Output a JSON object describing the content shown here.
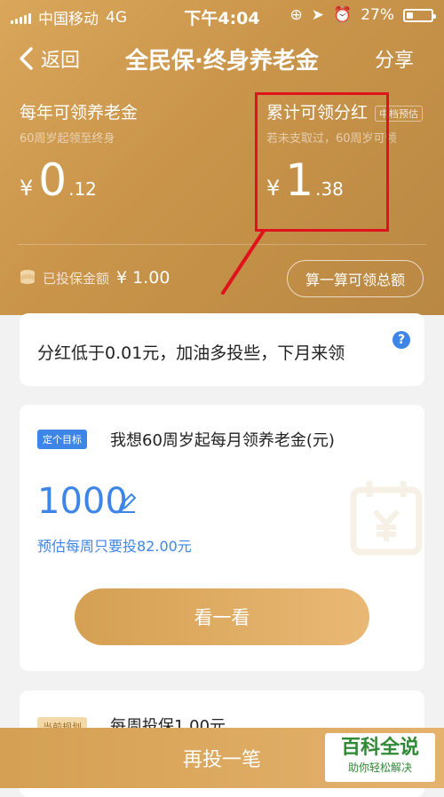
{
  "status_bar": {
    "carrier": "中国移动",
    "network": "4G",
    "time": "下午4:04",
    "battery": "27%",
    "battery_level": 0.27
  },
  "nav": {
    "back_label": "返回",
    "title": "全民保·终身养老金",
    "share_label": "分享"
  },
  "annual": {
    "title": "每年可领养老金",
    "subtitle": "60周岁起领至终身",
    "currency": "¥",
    "integer": "0",
    "decimal": ".12"
  },
  "dividend": {
    "title": "累计可领分红",
    "tag": "中档预估",
    "subtitle": "若未支取过，60周岁可领",
    "currency": "¥",
    "integer": "1",
    "decimal": ".38"
  },
  "insured": {
    "label": "已投保金额",
    "value": "¥ 1.00"
  },
  "calc_button": "算一算可领总额",
  "notice": {
    "text": "分红低于0.01元，加油多投些，下月来领",
    "help": "?"
  },
  "goal": {
    "badge": "定个目标",
    "title": "我想60周岁起每月领养老金(元)",
    "amount": "1000",
    "estimate": "预估每周只要投82.00元",
    "button": "看一看"
  },
  "plan": {
    "badge": "当前规划",
    "title": "每周投保1.00元"
  },
  "bottom_button": "再投一笔",
  "watermark": {
    "title": "百科全说",
    "subtitle": "助你轻松解决"
  },
  "colors": {
    "brand_gold": "#c9944a",
    "accent_blue": "#3d86e7",
    "highlight_red": "#e0131c"
  }
}
